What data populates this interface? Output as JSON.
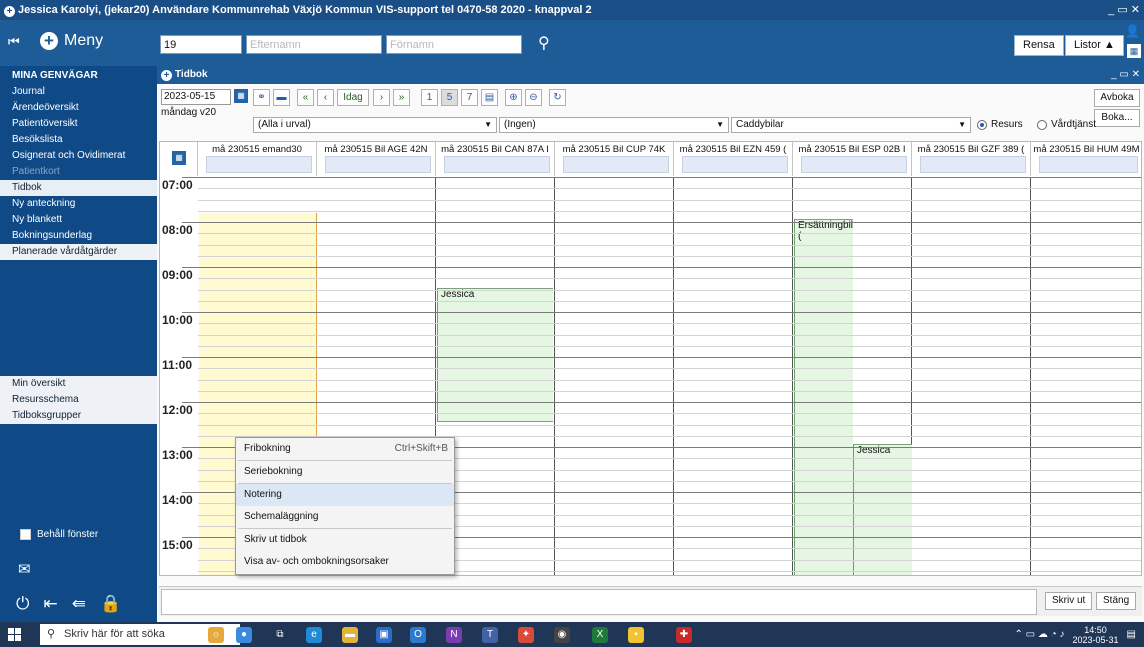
{
  "window": {
    "title": "Jessica  Karolyi, (jekar20) Användare Kommunrehab Växjö Kommun    VIS-support tel 0470-58 2020  - knappval 2",
    "controls": "_ ▭ ✕"
  },
  "menubar": {
    "menu_label": "Meny",
    "pnr_value": "19",
    "efternamn_placeholder": "Efternamn",
    "fornamn_placeholder": "Förnamn",
    "rensa_label": "Rensa",
    "listor_label": "Listor ▲"
  },
  "sidebar": {
    "header": "MINA GENVÄGAR",
    "items": [
      "Journal",
      "Ärendeöversikt",
      "Patientöversikt",
      "Besökslista",
      "Osignerat och Ovidimerat",
      "Patientkort",
      "Tidbok",
      "Ny anteckning",
      "Ny blankett",
      "Bokningsunderlag",
      "Planerade vårdåtgärder"
    ],
    "items2": [
      "Min översikt",
      "Resursschema",
      "Tidboksgrupper"
    ],
    "keep_window": "Behåll fönster"
  },
  "tidbok": {
    "title": "Tidbok",
    "date": "2023-05-15",
    "weekday": "måndag v20",
    "idag": "Idag",
    "view_buttons": [
      "1",
      "5",
      "7"
    ],
    "avboka": "Avboka",
    "boka": "Boka...",
    "filter1": "(Alla i urval)",
    "filter2": "(Ingen)",
    "filter3": "Caddybilar",
    "radio_resurs": "Resurs",
    "radio_vardtjanst": "Vårdtjänst",
    "columns": [
      "må 230515 emand30",
      "må 230515 Bil AGE 42N",
      "må 230515 Bil CAN 87A I",
      "må 230515 Bil CUP 74K",
      "må 230515 Bil EZN 459 (",
      "må 230515 Bil ESP 02B I",
      "må 230515 Bil GZF 389 (",
      "må 230515 Bil HUM 49M"
    ],
    "times": [
      "07:00",
      "08:00",
      "09:00",
      "10:00",
      "11:00",
      "12:00",
      "13:00",
      "14:00",
      "15:00"
    ],
    "appointments": {
      "jessica_can": "Jessica",
      "ersattningbil": "Ersättningbil (",
      "jessica_esp": "Jessica"
    },
    "skriv_ut": "Skriv ut",
    "stang": "Stäng"
  },
  "context_menu": {
    "items": [
      {
        "label": "Fribokning",
        "shortcut": "Ctrl+Skift+B"
      },
      {
        "label": "Seriebokning",
        "shortcut": ""
      },
      {
        "label": "Notering",
        "shortcut": ""
      },
      {
        "label": "Schemaläggning",
        "shortcut": ""
      },
      {
        "label": "Skriv ut tidbok",
        "shortcut": ""
      },
      {
        "label": "Visa av- och ombokningsorsaker",
        "shortcut": ""
      }
    ]
  },
  "taskbar": {
    "search_placeholder": "Skriv här för att söka",
    "time": "14:50",
    "date": "2023-05-31"
  }
}
